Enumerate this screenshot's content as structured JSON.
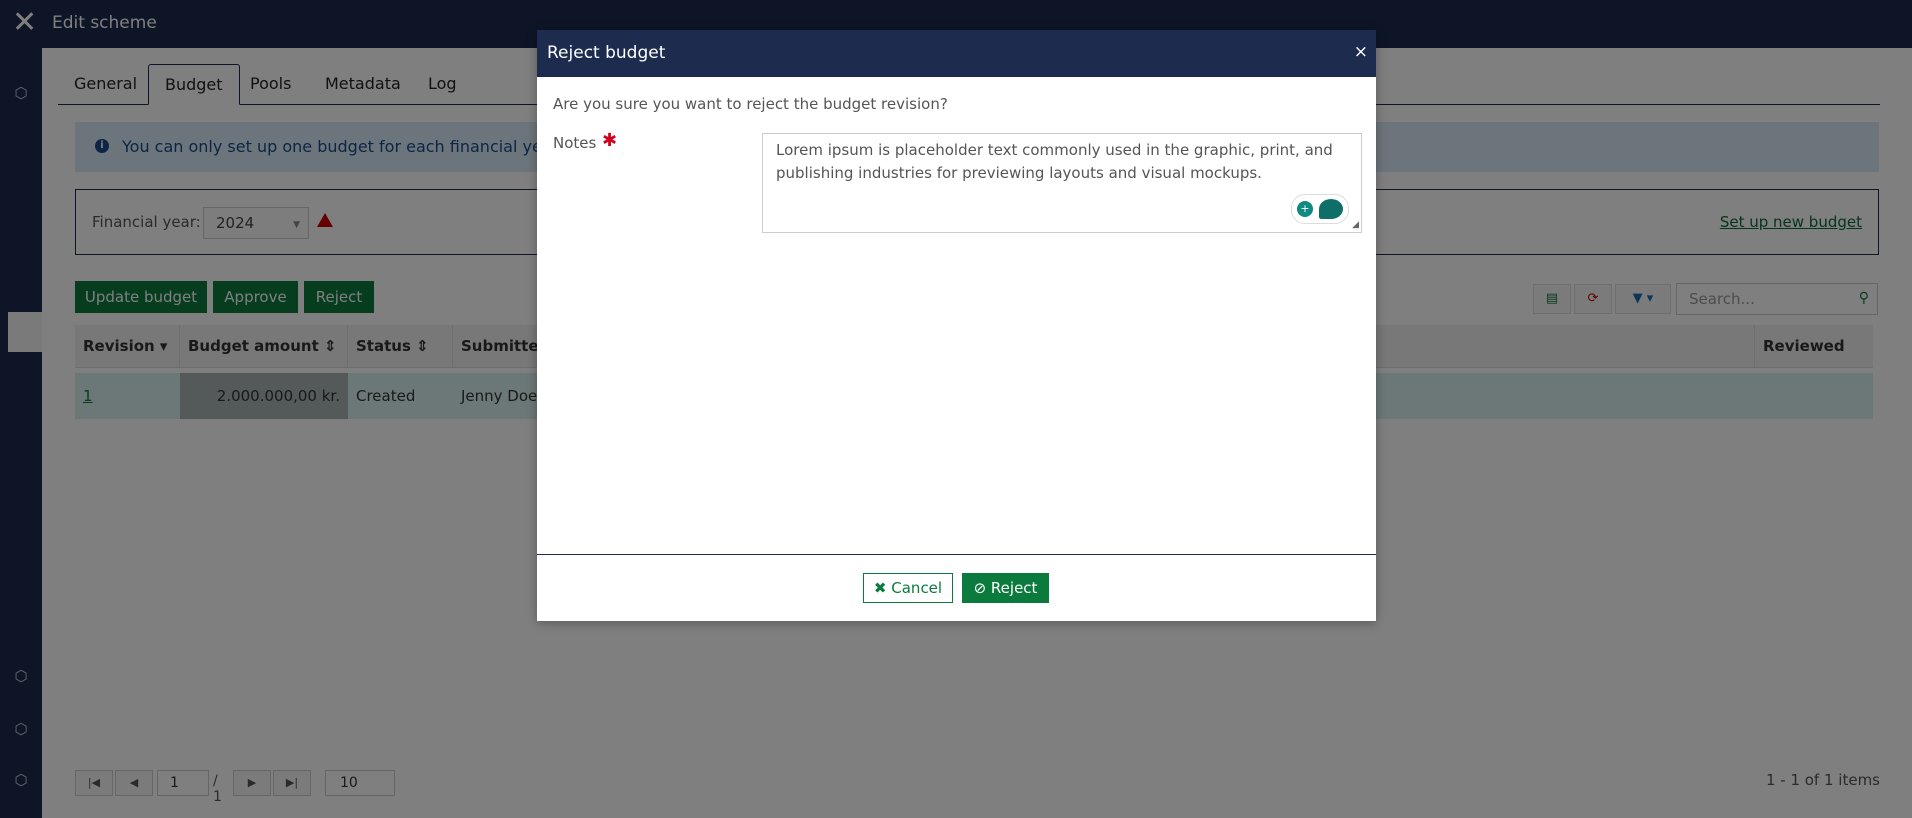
{
  "window": {
    "title": "Edit scheme"
  },
  "tabs": [
    {
      "label": "General"
    },
    {
      "label": "Budget"
    },
    {
      "label": "Pools"
    },
    {
      "label": "Metadata"
    },
    {
      "label": "Log"
    }
  ],
  "info": {
    "text": "You can only set up one budget for each financial year. All b"
  },
  "financial_year": {
    "label": "Financial year:",
    "value": "2024",
    "setup_link": "Set up new budget"
  },
  "actions": {
    "update": "Update budget",
    "approve": "Approve",
    "reject": "Reject"
  },
  "search": {
    "placeholder": "Search..."
  },
  "grid": {
    "headers": [
      "Revision",
      "Budget amount",
      "Status",
      "Submitted",
      "Reviewed date"
    ],
    "rows": [
      {
        "revision": "1",
        "amount": "2.000.000,00 kr.",
        "status": "Created",
        "submitted": "Jenny Doe"
      }
    ]
  },
  "pager": {
    "page": "1",
    "of": "/ 1",
    "page_size": "10",
    "count": "1 - 1 of 1 items"
  },
  "modal": {
    "title": "Reject budget",
    "question": "Are you sure you want to reject the budget revision?",
    "notes_label": "Notes",
    "notes_value": "Lorem ipsum is placeholder text commonly used in the graphic, print, and publishing industries for previewing layouts and visual mockups.",
    "cancel": "Cancel",
    "reject": "Reject"
  },
  "colors": {
    "navy": "#1c2b4e",
    "green": "#0b7a3d",
    "info_bg": "#d9eaf7"
  }
}
